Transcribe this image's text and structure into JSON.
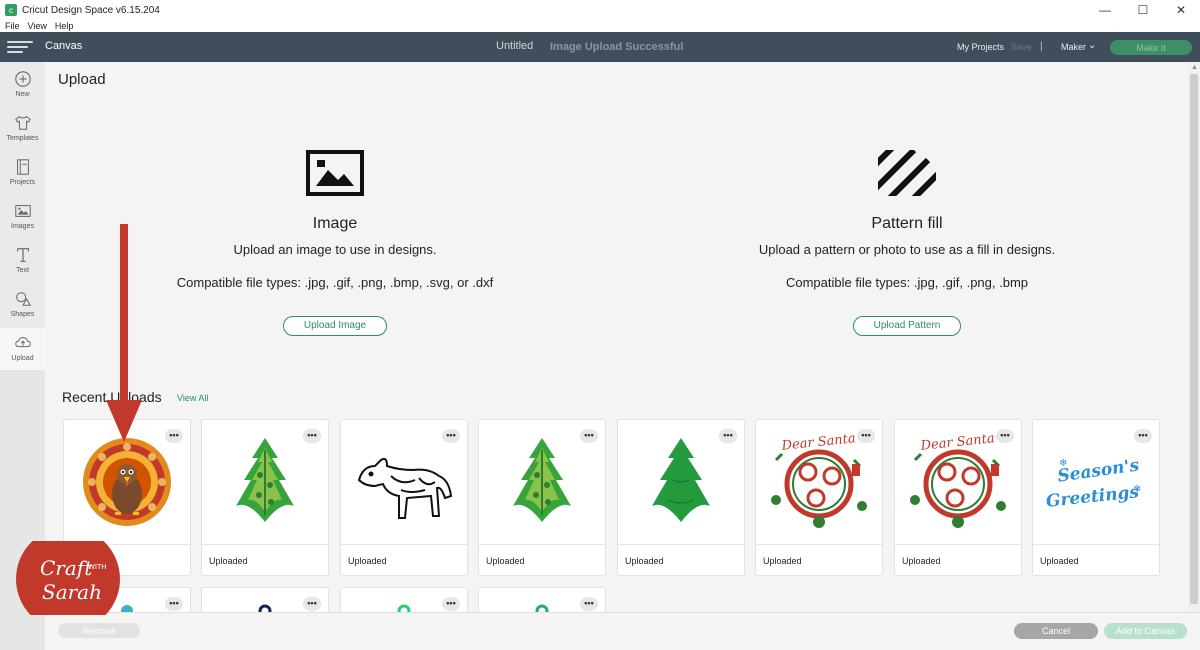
{
  "window": {
    "title": "Cricut Design Space  v6.15.204",
    "menu": [
      "File",
      "View",
      "Help"
    ],
    "controls": [
      "—",
      "☐",
      "✕"
    ]
  },
  "header": {
    "canvas_label": "Canvas",
    "project_title": "Untitled",
    "status": "Image Upload Successful",
    "my_projects": "My Projects",
    "save": "Save",
    "separator": "|",
    "machine": "Maker",
    "make_it": "Make It"
  },
  "sidebar": {
    "items": [
      {
        "label": "New",
        "icon": "plus-circle-icon"
      },
      {
        "label": "Templates",
        "icon": "tshirt-icon"
      },
      {
        "label": "Projects",
        "icon": "notebook-icon"
      },
      {
        "label": "Images",
        "icon": "image-icon"
      },
      {
        "label": "Text",
        "icon": "text-icon"
      },
      {
        "label": "Shapes",
        "icon": "shapes-icon"
      },
      {
        "label": "Upload",
        "icon": "cloud-upload-icon"
      }
    ]
  },
  "main": {
    "title": "Upload",
    "image_option": {
      "title": "Image",
      "description": "Upload an image to use in designs.",
      "types": "Compatible file types: .jpg, .gif, .png, .bmp, .svg, or .dxf",
      "button": "Upload Image"
    },
    "pattern_option": {
      "title": "Pattern fill",
      "description": "Upload a pattern or photo to use as a fill in designs.",
      "types": "Compatible file types: .jpg, .gif, .png, .bmp",
      "button": "Upload Pattern"
    },
    "recent": {
      "title": "Recent Uploads",
      "view_all": "View All",
      "more_label": "•••",
      "cards": [
        {
          "label": "",
          "image": "turkey-mandala"
        },
        {
          "label": "Uploaded",
          "image": "layered-christmas-tree"
        },
        {
          "label": "Uploaded",
          "image": "dog-mandala"
        },
        {
          "label": "Uploaded",
          "image": "layered-christmas-tree"
        },
        {
          "label": "Uploaded",
          "image": "christmas-tree"
        },
        {
          "label": "Uploaded",
          "image": "dear-santa-wreath"
        },
        {
          "label": "Uploaded",
          "image": "dear-santa-wreath"
        },
        {
          "label": "Uploaded",
          "image": "seasons-greetings"
        }
      ],
      "wreath_text": "Dear Santa",
      "seasons_text_1": "Season's",
      "seasons_text_2": "Greetings"
    }
  },
  "footer": {
    "remove": "Remove",
    "cancel": "Cancel",
    "add_to_canvas": "Add to Canvas"
  },
  "logo": {
    "line1": "Craft",
    "line2": "WITH",
    "line3": "Sarah"
  },
  "colors": {
    "header_bg": "#404d5b",
    "accent": "#2f8c63",
    "arrow": "#c0392b"
  }
}
